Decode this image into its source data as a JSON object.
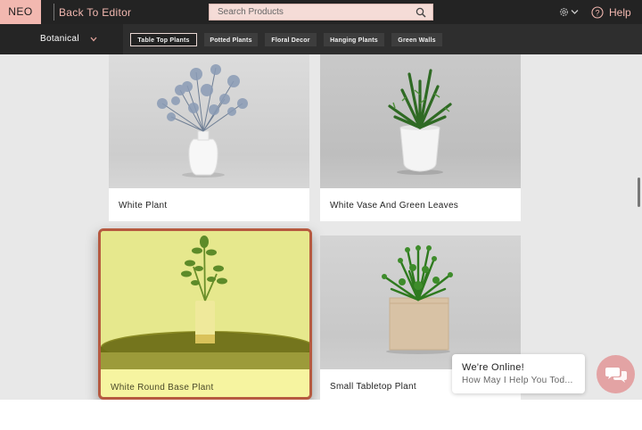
{
  "header": {
    "logo": "NEO",
    "back_link": "Back To Editor",
    "search_placeholder": "Search Products",
    "help_label": "Help",
    "icons": [
      "search-icon",
      "gear-icon",
      "chevron-down-icon",
      "help-icon"
    ]
  },
  "category_bar": {
    "selected_category": "Botanical",
    "tabs": [
      {
        "label": "Table Top Plants",
        "active": true
      },
      {
        "label": "Potted Plants",
        "active": false
      },
      {
        "label": "Floral Decor",
        "active": false
      },
      {
        "label": "Hanging Plants",
        "active": false
      },
      {
        "label": "Green Walls",
        "active": false
      }
    ]
  },
  "products": [
    {
      "name": "White Plant"
    },
    {
      "name": "White Vase And Green Leaves"
    },
    {
      "name": "White Round Base Plant",
      "highlighted": true
    },
    {
      "name": "Small Tabletop Plant"
    }
  ],
  "chat": {
    "title": "We're Online!",
    "subtitle": "How May I Help You Tod...",
    "icon": "chat-icon"
  },
  "colors": {
    "accent": "#f2b8b0",
    "topbar": "#232323",
    "highlight_border": "#b65a40",
    "highlight_fill": "#f6f4a0",
    "chat_button": "#e3a3a4"
  }
}
